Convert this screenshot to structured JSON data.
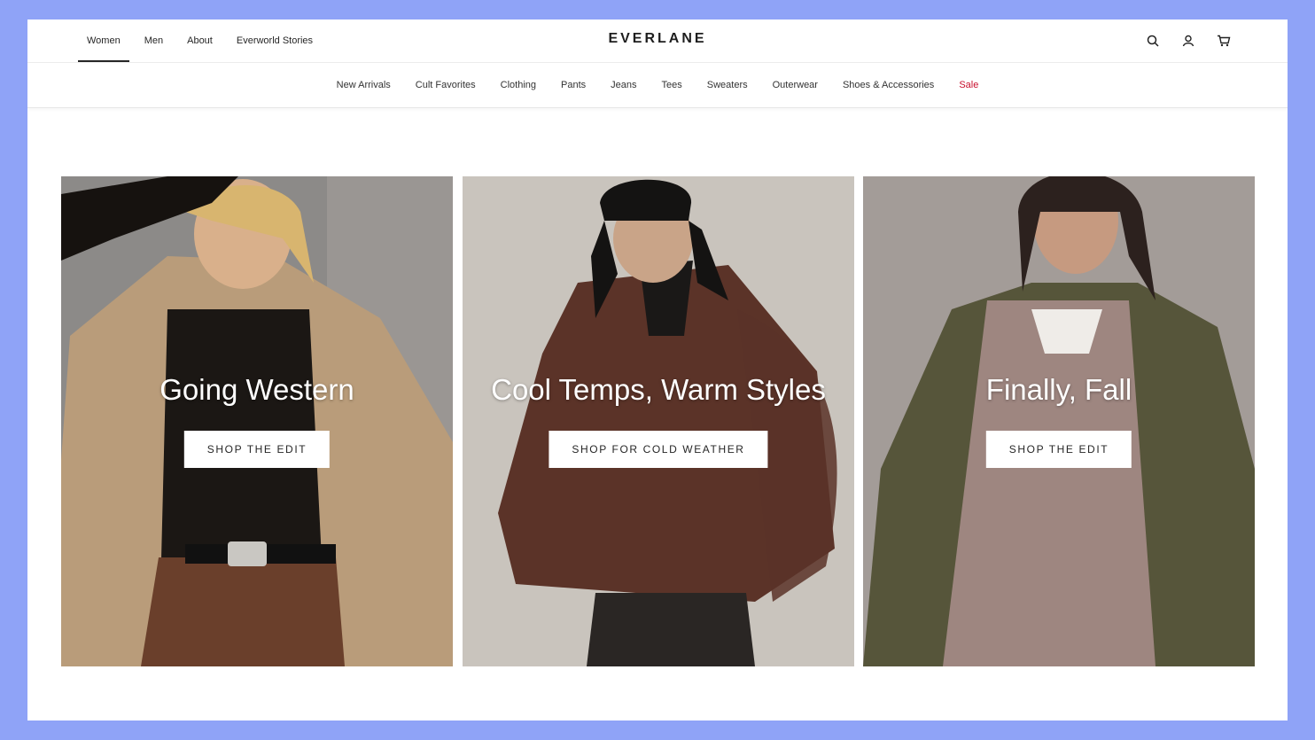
{
  "brand": {
    "logo": "EVERLANE",
    "accent": "#c8102e",
    "page_background": "#8fa3f7"
  },
  "top_nav": {
    "items": [
      "Women",
      "Men",
      "About",
      "Everworld Stories"
    ],
    "active": "Women"
  },
  "header_icons": [
    "search-icon",
    "account-icon",
    "cart-icon"
  ],
  "category_nav": {
    "items": [
      "New Arrivals",
      "Cult Favorites",
      "Clothing",
      "Pants",
      "Jeans",
      "Tees",
      "Sweaters",
      "Outerwear",
      "Shoes & Accessories",
      "Sale"
    ],
    "highlighted": "Sale"
  },
  "promos": [
    {
      "headline": "Going Western",
      "cta": "SHOP THE EDIT",
      "palette": [
        "#8c8a88",
        "#b99c7a",
        "#1b1714",
        "#6a3f2b"
      ]
    },
    {
      "headline": "Cool Temps, Warm Styles",
      "cta": "SHOP FOR COLD WEATHER",
      "palette": [
        "#c9c4bd",
        "#5b3328",
        "#1a1817",
        "#2a2624"
      ]
    },
    {
      "headline": "Finally, Fall",
      "cta": "SHOP THE EDIT",
      "palette": [
        "#a39c98",
        "#56553a",
        "#9e8680",
        "#2c211e"
      ]
    }
  ]
}
